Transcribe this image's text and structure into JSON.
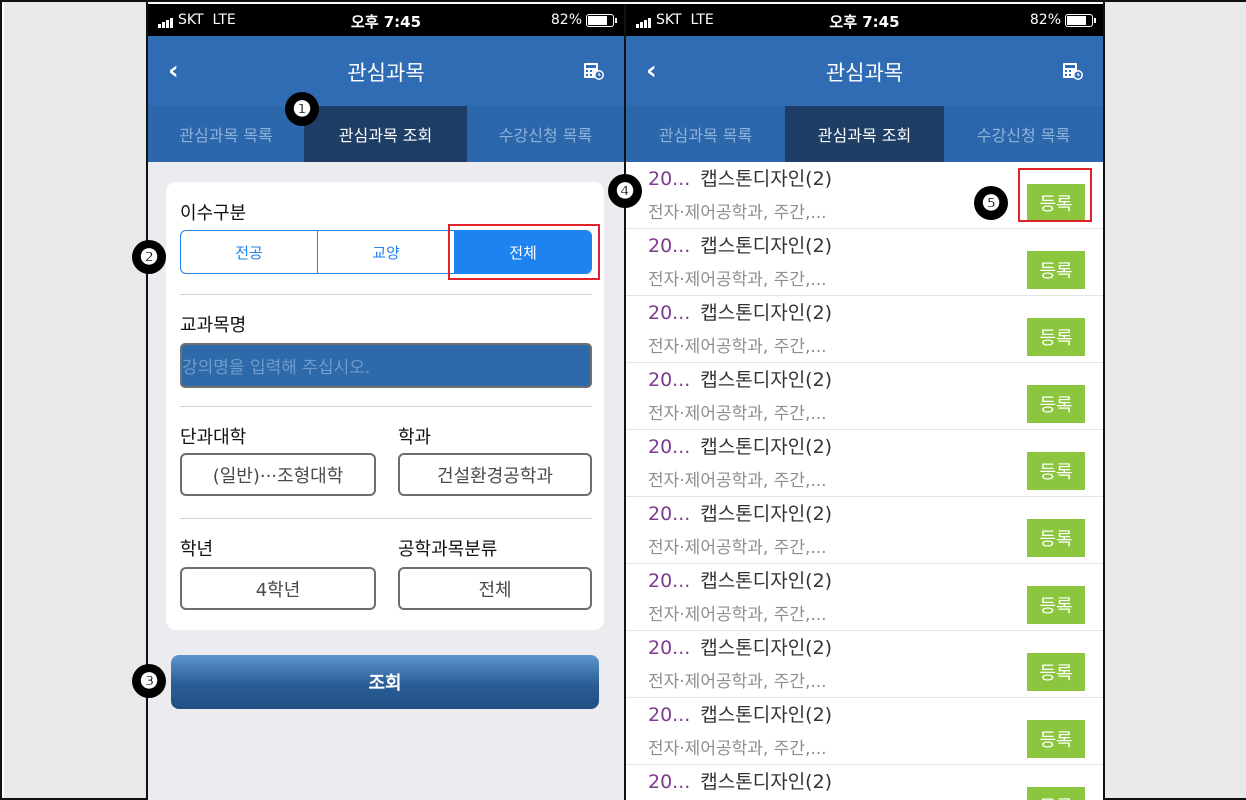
{
  "status_bar": {
    "carrier": "SKT",
    "network": "LTE",
    "time": "오후 7:45",
    "battery": "82%"
  },
  "nav": {
    "back_icon": "chevron-left",
    "title": "관심과목",
    "calculator_icon": "calculator-clock"
  },
  "tabs": [
    "관심과목 목록",
    "관심과목 조회",
    "수강신청 목록"
  ],
  "active_tab": 1,
  "search_form": {
    "completion_type_label": "이수구분",
    "completion_options": [
      "전공",
      "교양",
      "전체"
    ],
    "selected_completion": "전체",
    "course_name_label": "교과목명",
    "course_name_placeholder": "강의명을 입력해 주십시오.",
    "college_label": "단과대학",
    "college_value": "(일반)···조형대학",
    "department_label": "학과",
    "department_value": "건설환경공학과",
    "grade_label": "학년",
    "grade_value": "4학년",
    "eng_category_label": "공학과목분류",
    "eng_category_value": "전체",
    "search_button": "조회"
  },
  "results": [
    {
      "year": "20...",
      "course": "캡스톤디자인(2)",
      "detail": "전자·제어공학과, 주간,...",
      "button": "등록"
    },
    {
      "year": "20...",
      "course": "캡스톤디자인(2)",
      "detail": "전자·제어공학과, 주간,...",
      "button": "등록"
    },
    {
      "year": "20...",
      "course": "캡스톤디자인(2)",
      "detail": "전자·제어공학과, 주간,...",
      "button": "등록"
    },
    {
      "year": "20...",
      "course": "캡스톤디자인(2)",
      "detail": "전자·제어공학과, 주간,...",
      "button": "등록"
    },
    {
      "year": "20...",
      "course": "캡스톤디자인(2)",
      "detail": "전자·제어공학과, 주간,...",
      "button": "등록"
    },
    {
      "year": "20...",
      "course": "캡스톤디자인(2)",
      "detail": "전자·제어공학과, 주간,...",
      "button": "등록"
    },
    {
      "year": "20...",
      "course": "캡스톤디자인(2)",
      "detail": "전자·제어공학과, 주간,...",
      "button": "등록"
    },
    {
      "year": "20...",
      "course": "캡스톤디자인(2)",
      "detail": "전자·제어공학과, 주간,...",
      "button": "등록"
    },
    {
      "year": "20...",
      "course": "캡스톤디자인(2)",
      "detail": "전자·제어공학과, 주간,...",
      "button": "등록"
    },
    {
      "year": "20...",
      "course": "캡스톤디자인(2)",
      "detail": "",
      "button": "등록"
    }
  ],
  "annotations": [
    "❶",
    "❷",
    "❸",
    "❹",
    "❺"
  ],
  "colors": {
    "nav_blue": "#2f6cb3",
    "tab_active": "#1e3e66",
    "segment_blue": "#1e82f0",
    "register_green": "#8cc63f",
    "highlight_red": "#e0222a"
  }
}
